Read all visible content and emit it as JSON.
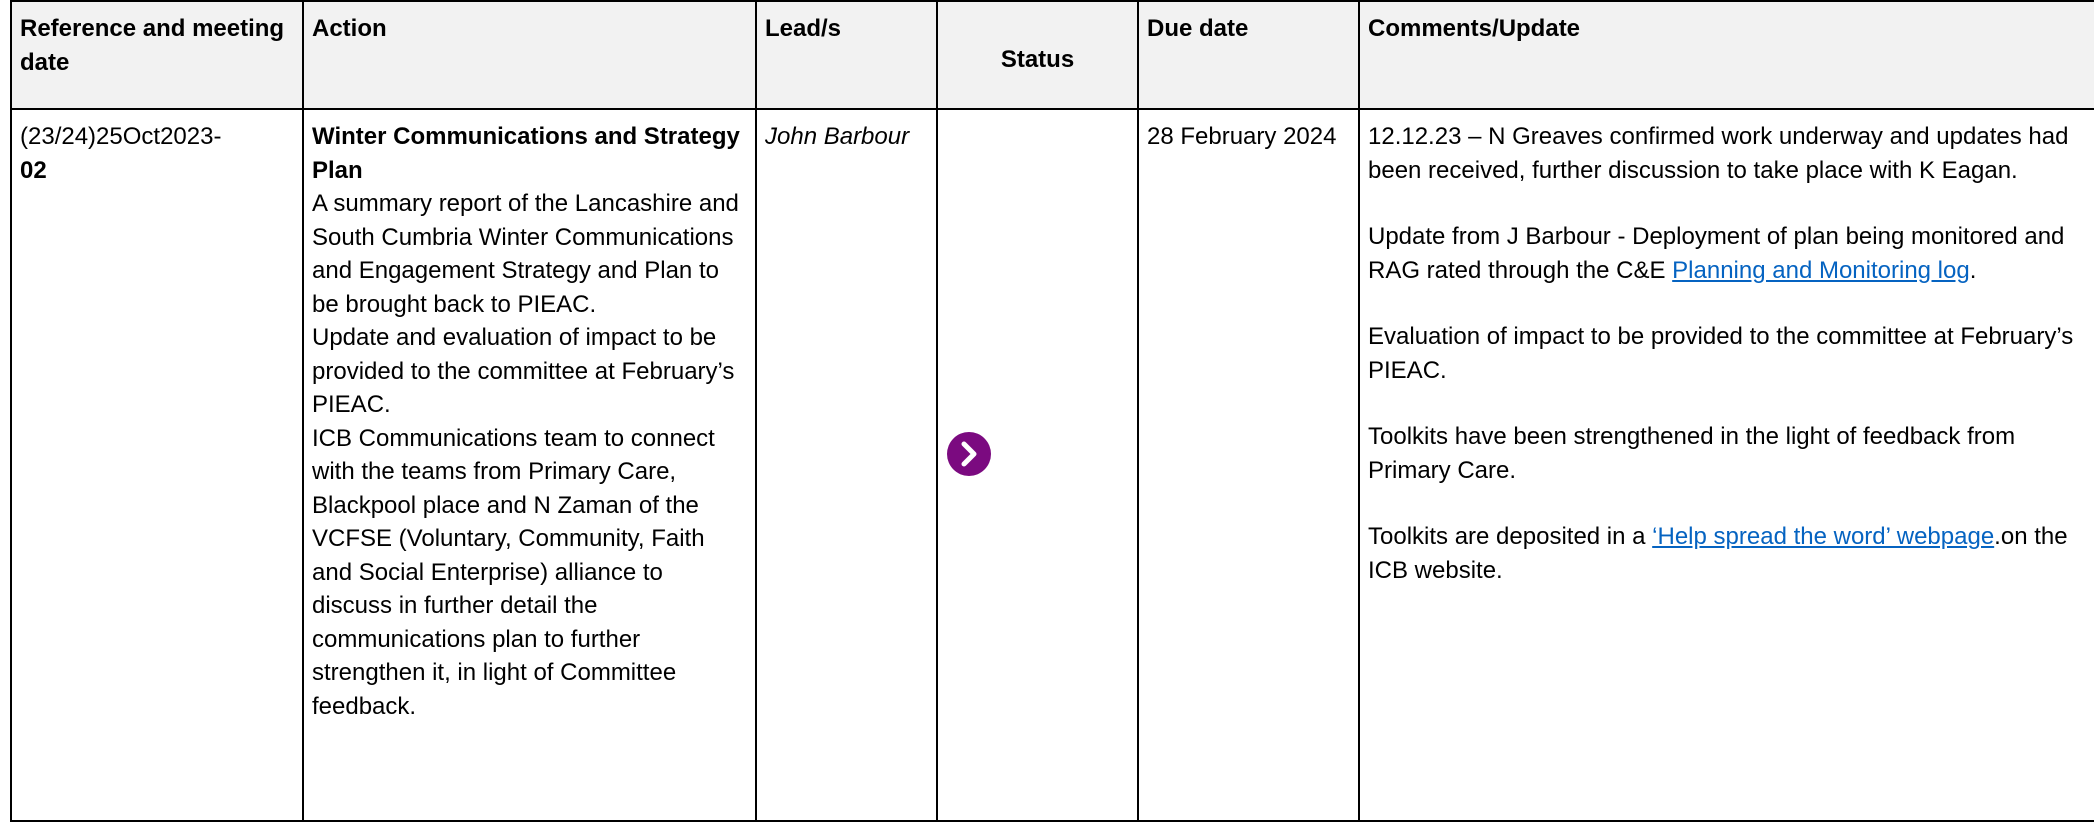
{
  "headers": {
    "reference": "Reference and meeting date",
    "action": "Action",
    "leads": "Lead/s",
    "status": "Status",
    "due_date": "Due date",
    "comments": "Comments/Update"
  },
  "row": {
    "reference_prefix": "(23/24)25Oct2023-",
    "reference_suffix": "02",
    "action_title": "Winter Communications and Strategy Plan",
    "action_body_1": "A summary report of the Lancashire and South Cumbria Winter Communications and Engagement Strategy and Plan to be brought back to PIEAC.",
    "action_body_2": "Update and evaluation of impact to be provided to the committee at February’s PIEAC.",
    "action_body_3": "ICB Communications team to connect with the teams from Primary Care, Blackpool place and N Zaman of the VCFSE (Voluntary, Community, Faith and Social Enterprise) alliance to discuss in further detail the communications plan to further strengthen it, in light of Committee feedback.",
    "lead": "John Barbour",
    "status_icon": "chevron-right-circle-icon",
    "status_color": "#7b0a80",
    "due_date": "28 February 2024",
    "comment_1": "12.12.23 – N Greaves confirmed work underway and updates had been received, further discussion to take place with K Eagan.",
    "comment_2_text": "Update from J Barbour - Deployment of plan being monitored and RAG rated through the C&E ",
    "comment_2_link": "Planning and Monitoring log",
    "comment_2_end": ".",
    "comment_3": "Evaluation of impact to be provided to the committee at February’s PIEAC.",
    "comment_4": "Toolkits have been strengthened in the light of feedback from Primary Care.",
    "comment_5_text": "Toolkits are deposited in a ",
    "comment_5_link": "‘Help spread the word’ webpage",
    "comment_5_end": ".on the ICB website."
  }
}
